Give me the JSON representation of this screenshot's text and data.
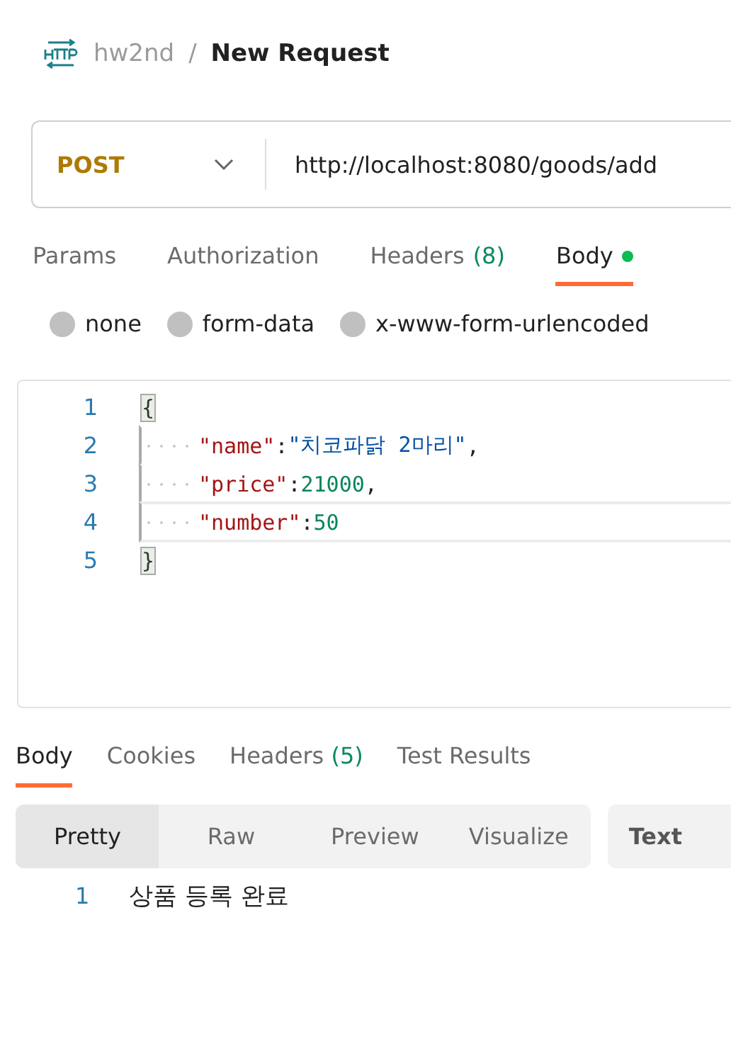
{
  "breadcrumb": {
    "collection": "hw2nd",
    "separator": "/",
    "request": "New Request"
  },
  "request": {
    "method": "POST",
    "url": "http://localhost:8080/goods/add"
  },
  "request_tabs": [
    {
      "label": "Params",
      "selected": false,
      "dot": false
    },
    {
      "label": "Authorization",
      "selected": false,
      "dot": false
    },
    {
      "label": "Headers",
      "count": "(8)",
      "selected": false,
      "dot": false
    },
    {
      "label": "Body",
      "selected": true,
      "dot": true
    }
  ],
  "body_types": [
    {
      "label": "none",
      "selected": false
    },
    {
      "label": "form-data",
      "selected": false
    },
    {
      "label": "x-www-form-urlencoded",
      "selected": false
    }
  ],
  "editor": {
    "lines": [
      {
        "number": "1",
        "indented": false,
        "active": false,
        "tokens": [
          {
            "kind": "brace",
            "text": "{"
          }
        ]
      },
      {
        "number": "2",
        "indented": true,
        "active": false,
        "tokens": [
          {
            "kind": "key",
            "text": "\"name\""
          },
          {
            "kind": "punct",
            "text": ":"
          },
          {
            "kind": "string",
            "text": "\"치코파닭 2마리\""
          },
          {
            "kind": "punct",
            "text": ","
          }
        ]
      },
      {
        "number": "3",
        "indented": true,
        "active": false,
        "tokens": [
          {
            "kind": "key",
            "text": "\"price\""
          },
          {
            "kind": "punct",
            "text": ":"
          },
          {
            "kind": "number",
            "text": "21000"
          },
          {
            "kind": "punct",
            "text": ","
          }
        ]
      },
      {
        "number": "4",
        "indented": true,
        "active": true,
        "tokens": [
          {
            "kind": "key",
            "text": "\"number\""
          },
          {
            "kind": "punct",
            "text": ":"
          },
          {
            "kind": "number",
            "text": "50"
          }
        ]
      },
      {
        "number": "5",
        "indented": false,
        "active": false,
        "tokens": [
          {
            "kind": "brace",
            "text": "}"
          }
        ]
      }
    ]
  },
  "response_tabs": [
    {
      "label": "Body",
      "selected": true
    },
    {
      "label": "Cookies",
      "selected": false
    },
    {
      "label": "Headers",
      "count": "(5)",
      "selected": false
    },
    {
      "label": "Test Results",
      "selected": false
    }
  ],
  "view_modes": [
    {
      "label": "Pretty",
      "selected": true
    },
    {
      "label": "Raw",
      "selected": false
    },
    {
      "label": "Preview",
      "selected": false
    },
    {
      "label": "Visualize",
      "selected": false
    }
  ],
  "format": "Text",
  "response_lines": [
    {
      "number": "1",
      "text": "상품 등록 완료"
    }
  ]
}
